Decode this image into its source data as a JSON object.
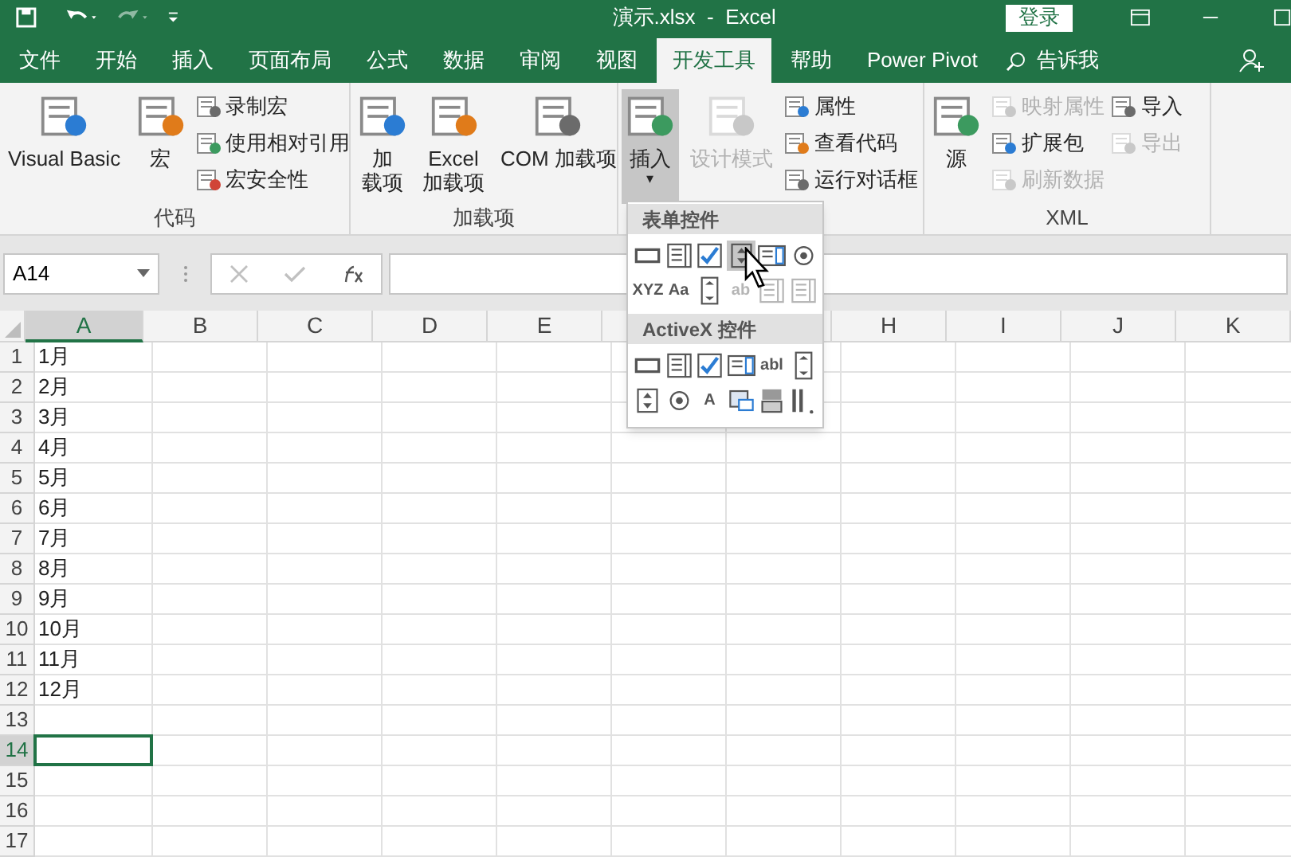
{
  "title_bar": {
    "title": "演示.xlsx  -  Excel",
    "sign_in": "登录"
  },
  "tabs": [
    {
      "label": "文件",
      "selected": false
    },
    {
      "label": "开始",
      "selected": false
    },
    {
      "label": "插入",
      "selected": false
    },
    {
      "label": "页面布局",
      "selected": false
    },
    {
      "label": "公式",
      "selected": false
    },
    {
      "label": "数据",
      "selected": false
    },
    {
      "label": "审阅",
      "selected": false
    },
    {
      "label": "视图",
      "selected": false
    },
    {
      "label": "开发工具",
      "selected": true
    },
    {
      "label": "帮助",
      "selected": false
    },
    {
      "label": "Power Pivot",
      "selected": false
    }
  ],
  "tell_me": "告诉我",
  "ribbon_groups": [
    {
      "label": "代码",
      "columns": [
        {
          "kind": "large",
          "lines": [
            "Visual Basic"
          ],
          "disabled": false,
          "pressed": false
        },
        {
          "kind": "large",
          "lines": [
            "宏"
          ],
          "disabled": false,
          "pressed": false
        },
        {
          "kind": "stack",
          "items": [
            {
              "label": "录制宏",
              "disabled": false
            },
            {
              "label": "使用相对引用",
              "disabled": false
            },
            {
              "label": "宏安全性",
              "disabled": false
            }
          ]
        }
      ]
    },
    {
      "label": "加载项",
      "columns": [
        {
          "kind": "large",
          "lines": [
            "加",
            "载项"
          ],
          "disabled": false,
          "pressed": false
        },
        {
          "kind": "large",
          "lines": [
            "Excel",
            "加载项"
          ],
          "disabled": false,
          "pressed": false
        },
        {
          "kind": "large",
          "lines": [
            "COM 加载项"
          ],
          "disabled": false,
          "pressed": false
        }
      ]
    },
    {
      "columns": [
        {
          "kind": "large",
          "lines": [
            "插入"
          ],
          "disabled": false,
          "pressed": true,
          "caret": "▾"
        },
        {
          "kind": "large",
          "lines": [
            "设计模式"
          ],
          "disabled": true,
          "pressed": false
        },
        {
          "kind": "stack",
          "items": [
            {
              "label": "属性",
              "disabled": false
            },
            {
              "label": "查看代码",
              "disabled": false
            },
            {
              "label": "运行对话框",
              "disabled": false
            }
          ]
        }
      ]
    },
    {
      "label": "XML",
      "columns": [
        {
          "kind": "large",
          "lines": [
            "源"
          ],
          "disabled": false,
          "pressed": false
        },
        {
          "kind": "stack",
          "items": [
            {
              "label": "映射属性",
              "disabled": true
            },
            {
              "label": "扩展包",
              "disabled": false
            },
            {
              "label": "刷新数据",
              "disabled": true
            }
          ]
        },
        {
          "kind": "stack",
          "items": [
            {
              "label": "导入",
              "disabled": false
            },
            {
              "label": "导出",
              "disabled": true
            }
          ]
        }
      ]
    }
  ],
  "name_box": {
    "value": "A14"
  },
  "columns": [
    {
      "label": "A",
      "selected": true
    },
    {
      "label": "B",
      "selected": false
    },
    {
      "label": "C",
      "selected": false
    },
    {
      "label": "D",
      "selected": false
    },
    {
      "label": "E",
      "selected": false
    },
    {
      "selected": false
    },
    {
      "selected": false
    },
    {
      "label": "H",
      "selected": false
    },
    {
      "label": "I",
      "selected": false
    },
    {
      "label": "J",
      "selected": false
    },
    {
      "label": "K",
      "selected": false
    }
  ],
  "rows": [
    {
      "label": "1",
      "a": "1月",
      "selected": false
    },
    {
      "label": "2",
      "a": "2月",
      "selected": false
    },
    {
      "label": "3",
      "a": "3月",
      "selected": false
    },
    {
      "label": "4",
      "a": "4月",
      "selected": false
    },
    {
      "label": "5",
      "a": "5月",
      "selected": false
    },
    {
      "label": "6",
      "a": "6月",
      "selected": false
    },
    {
      "label": "7",
      "a": "7月",
      "selected": false
    },
    {
      "label": "8",
      "a": "8月",
      "selected": false
    },
    {
      "label": "9",
      "a": "9月",
      "selected": false
    },
    {
      "label": "10",
      "a": "10月",
      "selected": false
    },
    {
      "label": "11",
      "a": "11月",
      "selected": false
    },
    {
      "label": "12",
      "a": "12月",
      "selected": false
    },
    {
      "label": "13",
      "selected": false
    },
    {
      "label": "14",
      "selected": true
    },
    {
      "label": "15",
      "selected": false
    },
    {
      "label": "16",
      "selected": false
    },
    {
      "label": "17",
      "selected": false
    }
  ],
  "controls_menu": [
    {
      "title": "表单控件",
      "items": [
        {
          "kind": "button",
          "disabled": false,
          "hovered": false
        },
        {
          "kind": "combo",
          "disabled": false,
          "hovered": false
        },
        {
          "kind": "checkbox",
          "disabled": false,
          "hovered": false
        },
        {
          "kind": "spin",
          "disabled": false,
          "hovered": true
        },
        {
          "kind": "list",
          "disabled": false,
          "hovered": false
        },
        {
          "kind": "option",
          "disabled": false,
          "hovered": false
        },
        {
          "kind": "group",
          "glyph": "XYZ",
          "disabled": false,
          "hovered": false
        },
        {
          "kind": "label",
          "glyph": "Aa",
          "disabled": false,
          "hovered": false
        },
        {
          "kind": "scroll",
          "disabled": false,
          "hovered": false
        },
        {
          "kind": "text",
          "glyph": "ab",
          "disabled": true,
          "hovered": false
        },
        {
          "kind": "combo",
          "disabled": true,
          "hovered": false
        },
        {
          "kind": "combo",
          "disabled": true,
          "hovered": false
        }
      ]
    },
    {
      "title": "ActiveX 控件",
      "items": [
        {
          "kind": "button",
          "disabled": false,
          "hovered": false
        },
        {
          "kind": "combo",
          "disabled": false,
          "hovered": false
        },
        {
          "kind": "checkbox",
          "disabled": false,
          "hovered": false
        },
        {
          "kind": "list",
          "disabled": false,
          "hovered": false
        },
        {
          "kind": "text",
          "glyph": "abl",
          "disabled": false,
          "hovered": false
        },
        {
          "kind": "scroll",
          "disabled": false,
          "hovered": false
        },
        {
          "kind": "spin",
          "disabled": false,
          "hovered": false
        },
        {
          "kind": "option",
          "disabled": false,
          "hovered": false
        },
        {
          "kind": "label",
          "glyph": "A",
          "disabled": false,
          "hovered": false
        },
        {
          "kind": "image",
          "disabled": false,
          "hovered": false
        },
        {
          "kind": "toggle",
          "disabled": false,
          "hovered": false
        },
        {
          "kind": "more",
          "disabled": false,
          "hovered": false
        }
      ]
    }
  ]
}
